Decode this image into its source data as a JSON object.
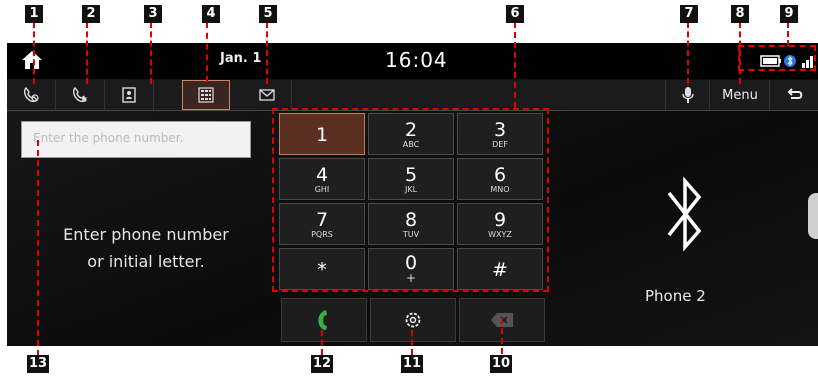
{
  "status": {
    "date": "Jan. 1",
    "time": "16:04"
  },
  "tabs": [
    {
      "icon": "recent-calls-icon"
    },
    {
      "icon": "favorites-icon"
    },
    {
      "icon": "contacts-icon"
    },
    {
      "icon": "dial-keypad-icon",
      "active": true
    },
    {
      "icon": "messages-icon"
    }
  ],
  "right_controls": {
    "voice_icon": "microphone-icon",
    "menu_label": "Menu",
    "back_icon": "back-arrow-icon"
  },
  "input": {
    "placeholder": "Enter the phone number."
  },
  "hint": {
    "line1": "Enter phone number",
    "line2": "or initial letter."
  },
  "keypad": [
    {
      "digit": "1",
      "letters": ""
    },
    {
      "digit": "2",
      "letters": "ABC"
    },
    {
      "digit": "3",
      "letters": "DEF"
    },
    {
      "digit": "4",
      "letters": "GHI"
    },
    {
      "digit": "5",
      "letters": "JKL"
    },
    {
      "digit": "6",
      "letters": "MNO"
    },
    {
      "digit": "7",
      "letters": "PQRS"
    },
    {
      "digit": "8",
      "letters": "TUV"
    },
    {
      "digit": "9",
      "letters": "WXYZ"
    },
    {
      "digit": "*",
      "letters": ""
    },
    {
      "digit": "0",
      "letters": "+"
    },
    {
      "digit": "#",
      "letters": ""
    }
  ],
  "actions": {
    "call_icon": "call-icon",
    "settings_icon": "settings-icon",
    "delete_icon": "backspace-icon"
  },
  "device": {
    "name": "Phone 2",
    "icon": "bluetooth-icon"
  },
  "callouts": [
    "1",
    "2",
    "3",
    "4",
    "5",
    "6",
    "7",
    "8",
    "9",
    "10",
    "11",
    "12",
    "13"
  ],
  "colors": {
    "accent": "#c9866b",
    "call_green": "#3fae4a",
    "callout_line": "#e00000"
  }
}
